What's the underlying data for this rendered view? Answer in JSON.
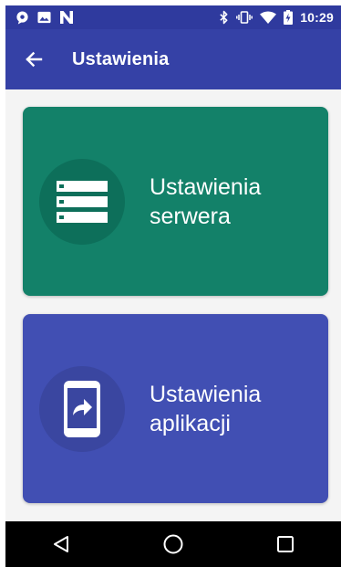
{
  "status_bar": {
    "time": "10:29",
    "left_icons": [
      "chat-bubble-icon",
      "image-icon",
      "n-logo-icon"
    ],
    "right_icons": [
      "bluetooth-icon",
      "vibrate-icon",
      "wifi-icon",
      "battery-charging-icon"
    ]
  },
  "app_bar": {
    "title": "Ustawienia",
    "back_icon": "arrow-back-icon"
  },
  "cards": [
    {
      "line1": "Ustawienia",
      "line2": "serwera",
      "icon": "server-list-icon",
      "color": "#138169",
      "circle_color": "#0d6f5a"
    },
    {
      "line1": "Ustawienia",
      "line2": "aplikacji",
      "icon": "phone-forward-icon",
      "color": "#414fb3",
      "circle_color": "#3a46a0"
    }
  ],
  "colors": {
    "status_bar": "#2f3a9e",
    "app_bar": "#3541a6",
    "background": "#f4f4f4",
    "nav_bar": "#000000"
  },
  "nav_bar": {
    "buttons": [
      "back-triangle-icon",
      "home-circle-icon",
      "recents-square-icon"
    ]
  }
}
